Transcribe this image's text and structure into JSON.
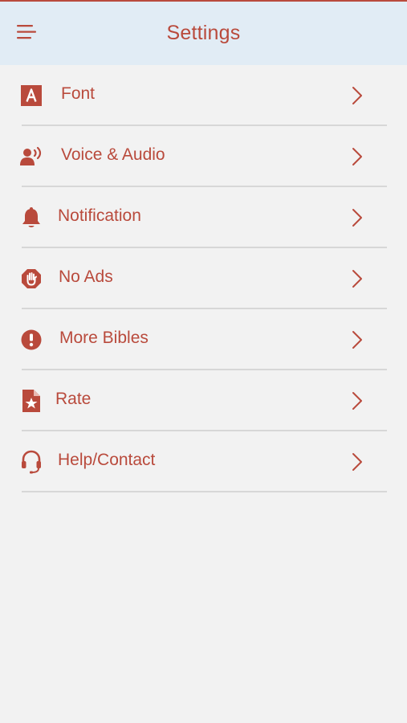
{
  "header": {
    "title": "Settings",
    "menu_icon": "hamburger-menu-icon"
  },
  "colors": {
    "accent": "#b94a3c",
    "header_bg": "#e1ecf5",
    "page_bg": "#f2f2f2",
    "divider": "#d7d7d7"
  },
  "settings": {
    "items": [
      {
        "label": "Font",
        "icon": "font-icon"
      },
      {
        "label": "Voice & Audio",
        "icon": "voice-audio-icon"
      },
      {
        "label": "Notification",
        "icon": "bell-icon"
      },
      {
        "label": "No Ads",
        "icon": "hand-stop-icon"
      },
      {
        "label": "More Bibles",
        "icon": "exclamation-circle-icon"
      },
      {
        "label": "Rate",
        "icon": "star-document-icon"
      },
      {
        "label": "Help/Contact",
        "icon": "headset-icon"
      }
    ]
  }
}
